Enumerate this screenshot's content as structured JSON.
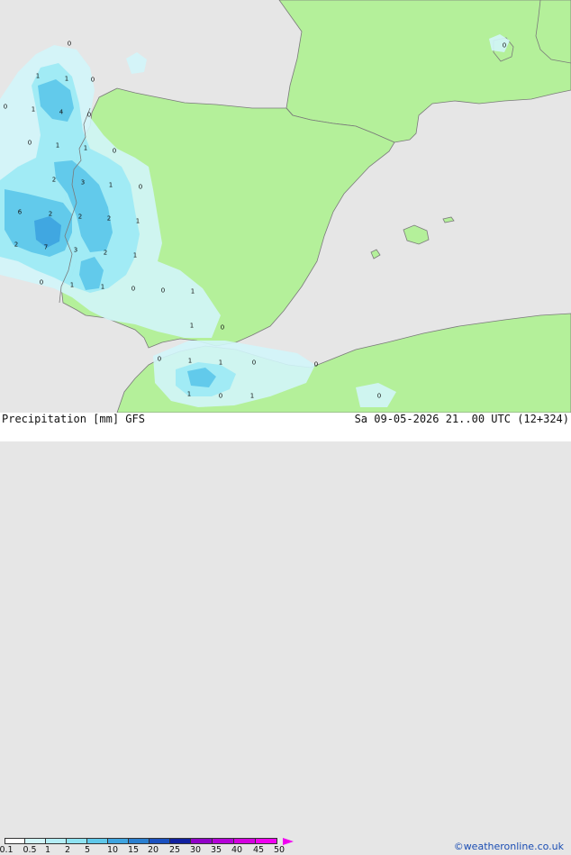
{
  "title": "Precipitation [mm]",
  "model": "GFS",
  "valid_time": "Sa 09-05-2026 21..00 UTC (12+324)",
  "credit": "©weatheronline.co.uk",
  "colors": {
    "sea": "#e6e6e6",
    "land": "#b4f09a",
    "border": "#7a7a7a",
    "precip_light": "#d2f5fa",
    "precip_mid": "#9eeaf4",
    "precip_strong": "#5fc8ea",
    "precip_heavy": "#3ea4e0"
  },
  "legend": {
    "ticks": [
      "0.1",
      "0.5",
      "1",
      "2",
      "5",
      "10",
      "15",
      "20",
      "25",
      "30",
      "35",
      "40",
      "45",
      "50"
    ],
    "colors": [
      "#ffffff",
      "#d2f5fa",
      "#b4eef7",
      "#8ee3f2",
      "#5fc8ea",
      "#3ea4e0",
      "#2a7fd0",
      "#1a50c0",
      "#1020a0",
      "#9000c8",
      "#b400d8",
      "#d400e0",
      "#f000f0"
    ]
  },
  "points": [
    {
      "label": "0"
    },
    {
      "label": "1"
    },
    {
      "label": "1"
    },
    {
      "label": "0"
    },
    {
      "label": "0"
    },
    {
      "label": "1"
    },
    {
      "label": "4"
    },
    {
      "label": "0"
    },
    {
      "label": "0"
    },
    {
      "label": "1"
    },
    {
      "label": "1"
    },
    {
      "label": "0"
    },
    {
      "label": "2"
    },
    {
      "label": "3"
    },
    {
      "label": "1"
    },
    {
      "label": "0"
    },
    {
      "label": "6"
    },
    {
      "label": "2"
    },
    {
      "label": "2"
    },
    {
      "label": "2"
    },
    {
      "label": "1"
    },
    {
      "label": "2"
    },
    {
      "label": "7"
    },
    {
      "label": "3"
    },
    {
      "label": "2"
    },
    {
      "label": "1"
    },
    {
      "label": "0"
    },
    {
      "label": "1"
    },
    {
      "label": "1"
    },
    {
      "label": "0"
    },
    {
      "label": "0"
    },
    {
      "label": "1"
    },
    {
      "label": "1"
    },
    {
      "label": "0"
    },
    {
      "label": "0"
    },
    {
      "label": "1"
    },
    {
      "label": "1"
    },
    {
      "label": "0"
    },
    {
      "label": "0"
    },
    {
      "label": "1"
    },
    {
      "label": "0"
    },
    {
      "label": "1"
    },
    {
      "label": "0"
    },
    {
      "label": "0"
    }
  ]
}
